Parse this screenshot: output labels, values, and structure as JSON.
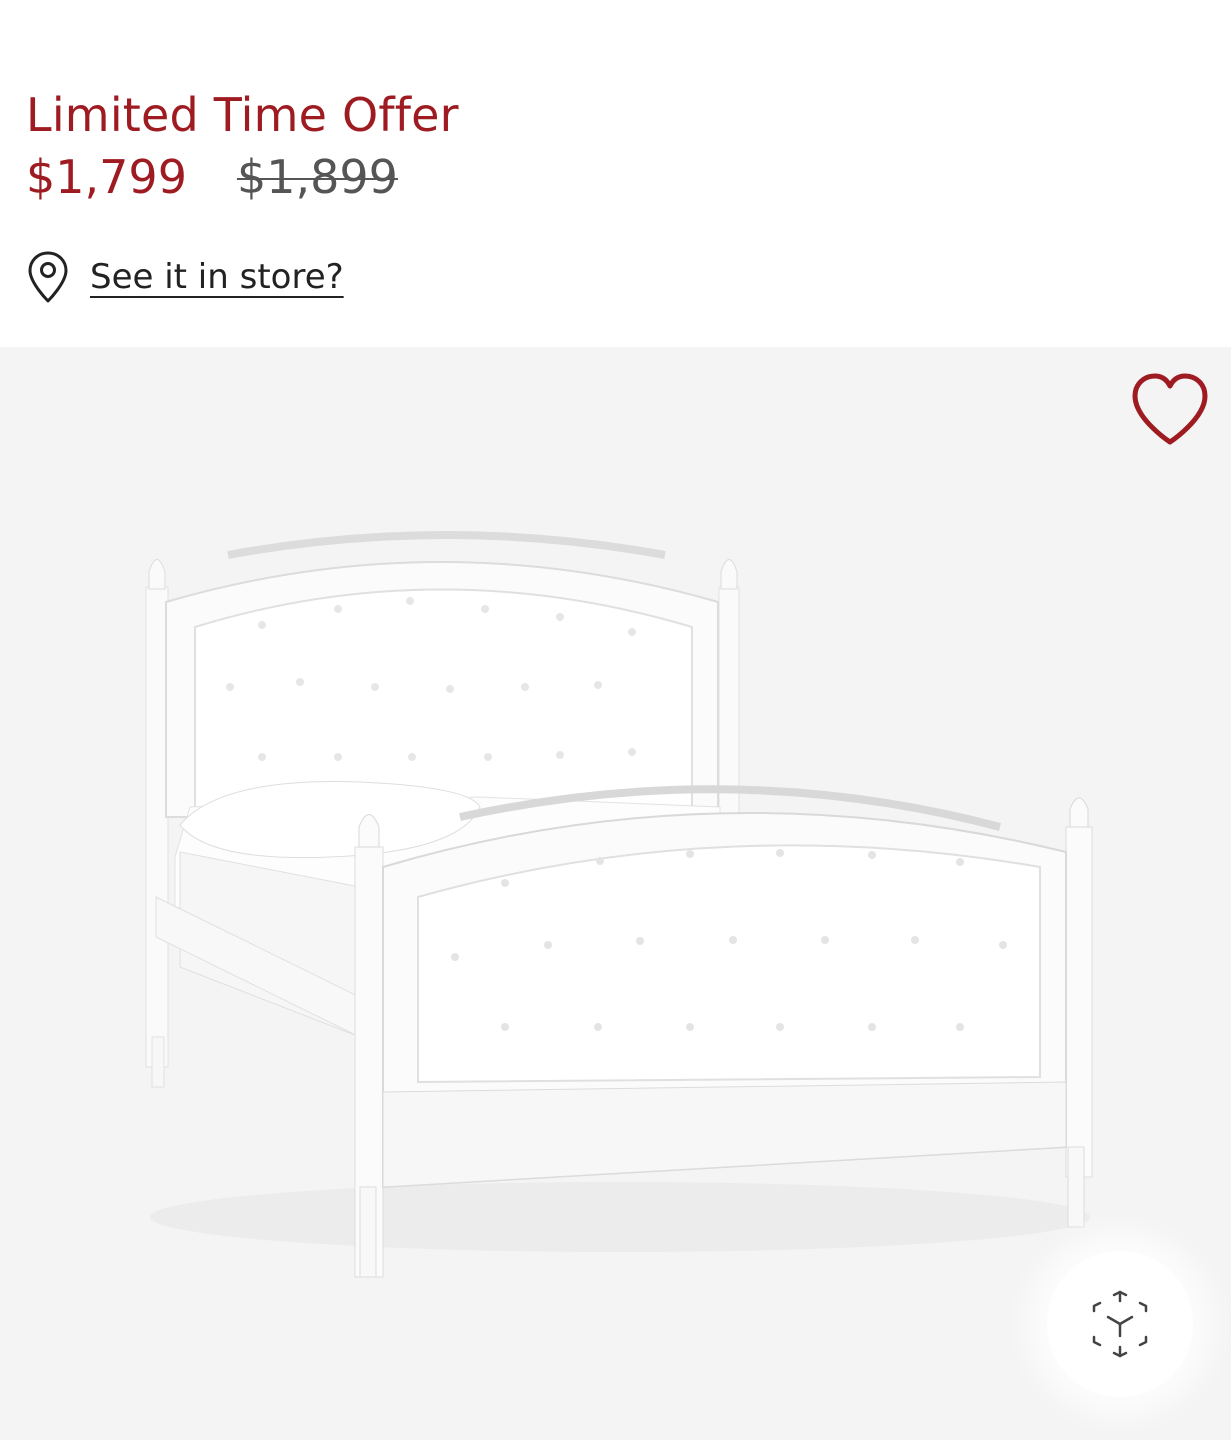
{
  "promo": {
    "label": "Limited Time Offer"
  },
  "price": {
    "sale": "$1,799",
    "original": "$1,899"
  },
  "store": {
    "link_label": "See it in store?",
    "icon": "location-pin-icon"
  },
  "gallery": {
    "image": "upholstered-tufted-bed",
    "favorite_icon": "heart-icon",
    "ar_icon": "3d-view-icon"
  },
  "colors": {
    "accent": "#9e1b22",
    "text": "#222222",
    "strikethrough_price": "#555555",
    "gallery_background": "#f4f4f4"
  }
}
